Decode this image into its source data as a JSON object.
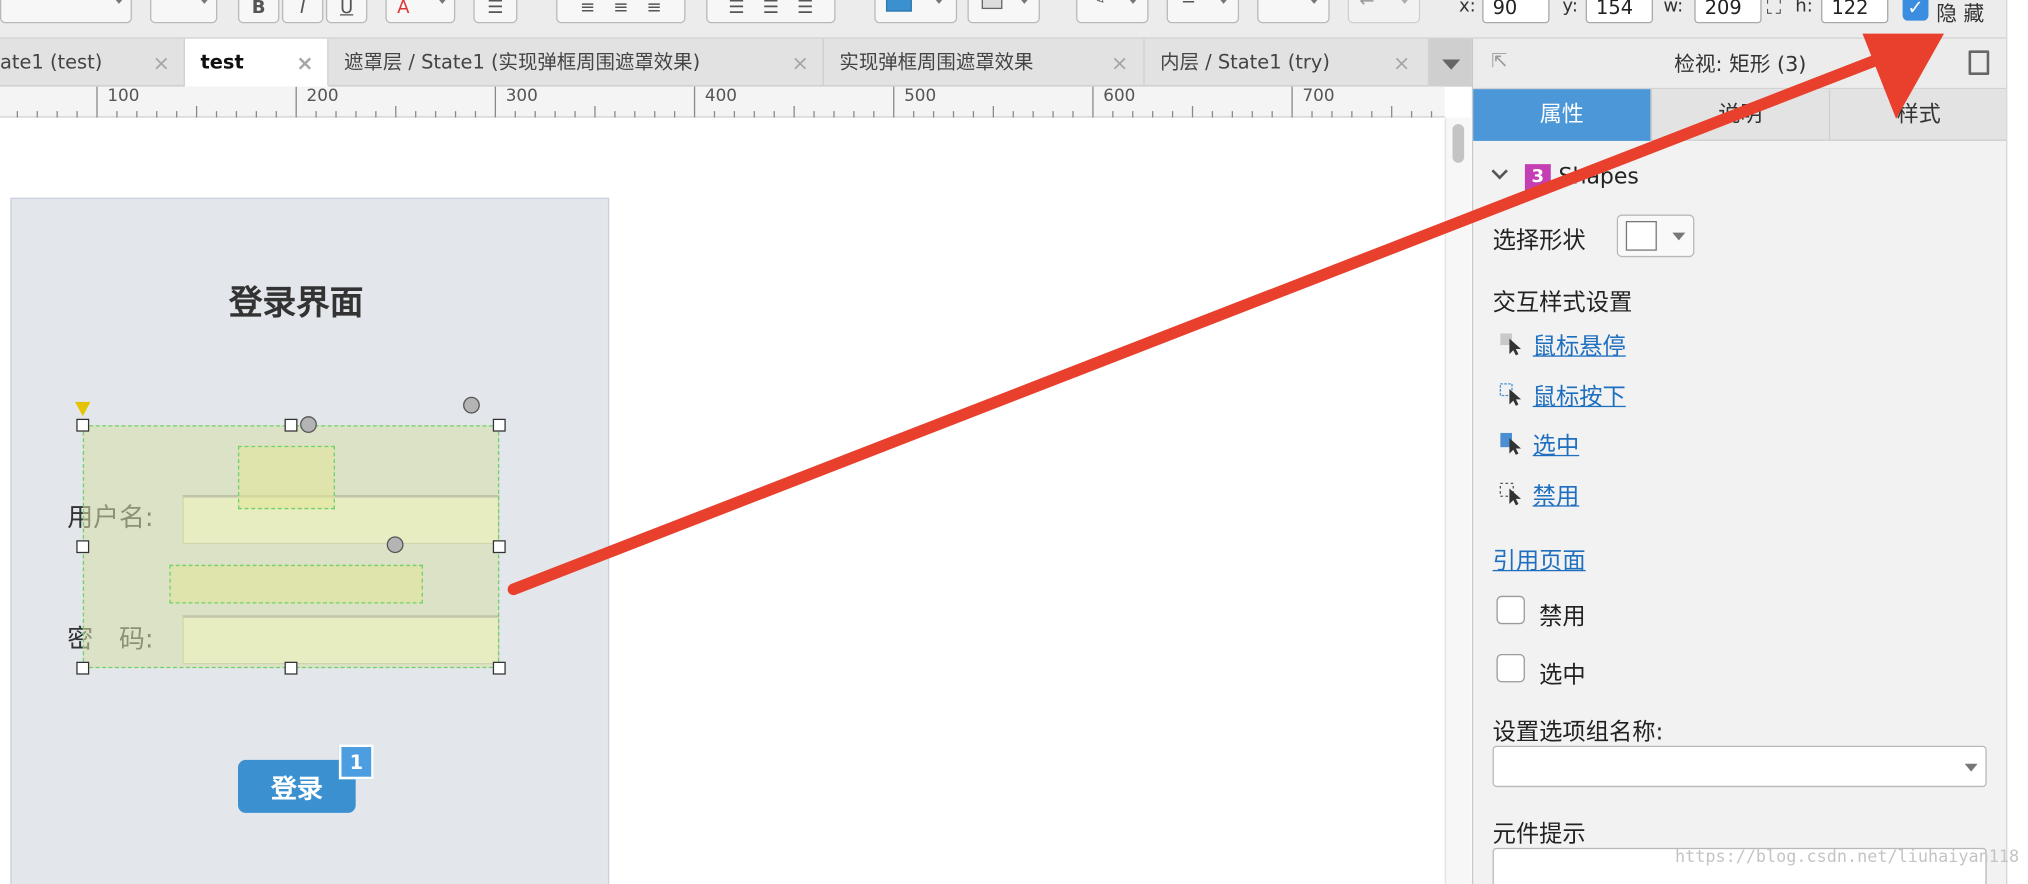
{
  "toolbar": {
    "bold_label": "B",
    "italic_label": "I",
    "underline_label": "U",
    "font_color_label": "A",
    "x_label": "x:",
    "x_value": "90",
    "y_label": "y:",
    "y_value": "154",
    "w_label": "w:",
    "w_value": "209",
    "h_label": "h:",
    "h_value": "122",
    "hide_label": "隐 藏",
    "hide_checked": true,
    "accent": "#3b91d0"
  },
  "tabs": [
    {
      "label": "ate1 (test)",
      "close": "×",
      "active": false
    },
    {
      "label": "test",
      "close": "×",
      "active": true
    },
    {
      "label": "遮罩层 / State1 (实现弹框周围遮罩效果)",
      "close": "×",
      "active": false
    },
    {
      "label": "实现弹框周围遮罩效果",
      "close": "×",
      "active": false
    },
    {
      "label": "内层 / State1 (try)",
      "close": "×",
      "active": false
    }
  ],
  "ruler": {
    "labels": [
      "100",
      "200",
      "300",
      "400",
      "500",
      "600",
      "700"
    ]
  },
  "canvas": {
    "title": "登录界面",
    "username_label": "用户名:",
    "password_label": "密　码:",
    "login_button": "登录",
    "badge": "1"
  },
  "inspector": {
    "title": "检视: 矩形 (3)",
    "tabs": [
      "属性",
      "说明",
      "样式"
    ],
    "shapes_badge": "3",
    "shapes_label": "Shapes",
    "select_shape_label": "选择形状",
    "interaction_style_label": "交互样式设置",
    "links": [
      "鼠标悬停",
      "鼠标按下",
      "选中",
      "禁用"
    ],
    "ref_page_link": "引用页面",
    "disabled_label": "禁用",
    "selected_label": "选中",
    "option_group_label": "设置选项组名称:",
    "tooltip_label": "元件提示"
  },
  "watermark": "https://blog.csdn.net/liuhaiyan118"
}
